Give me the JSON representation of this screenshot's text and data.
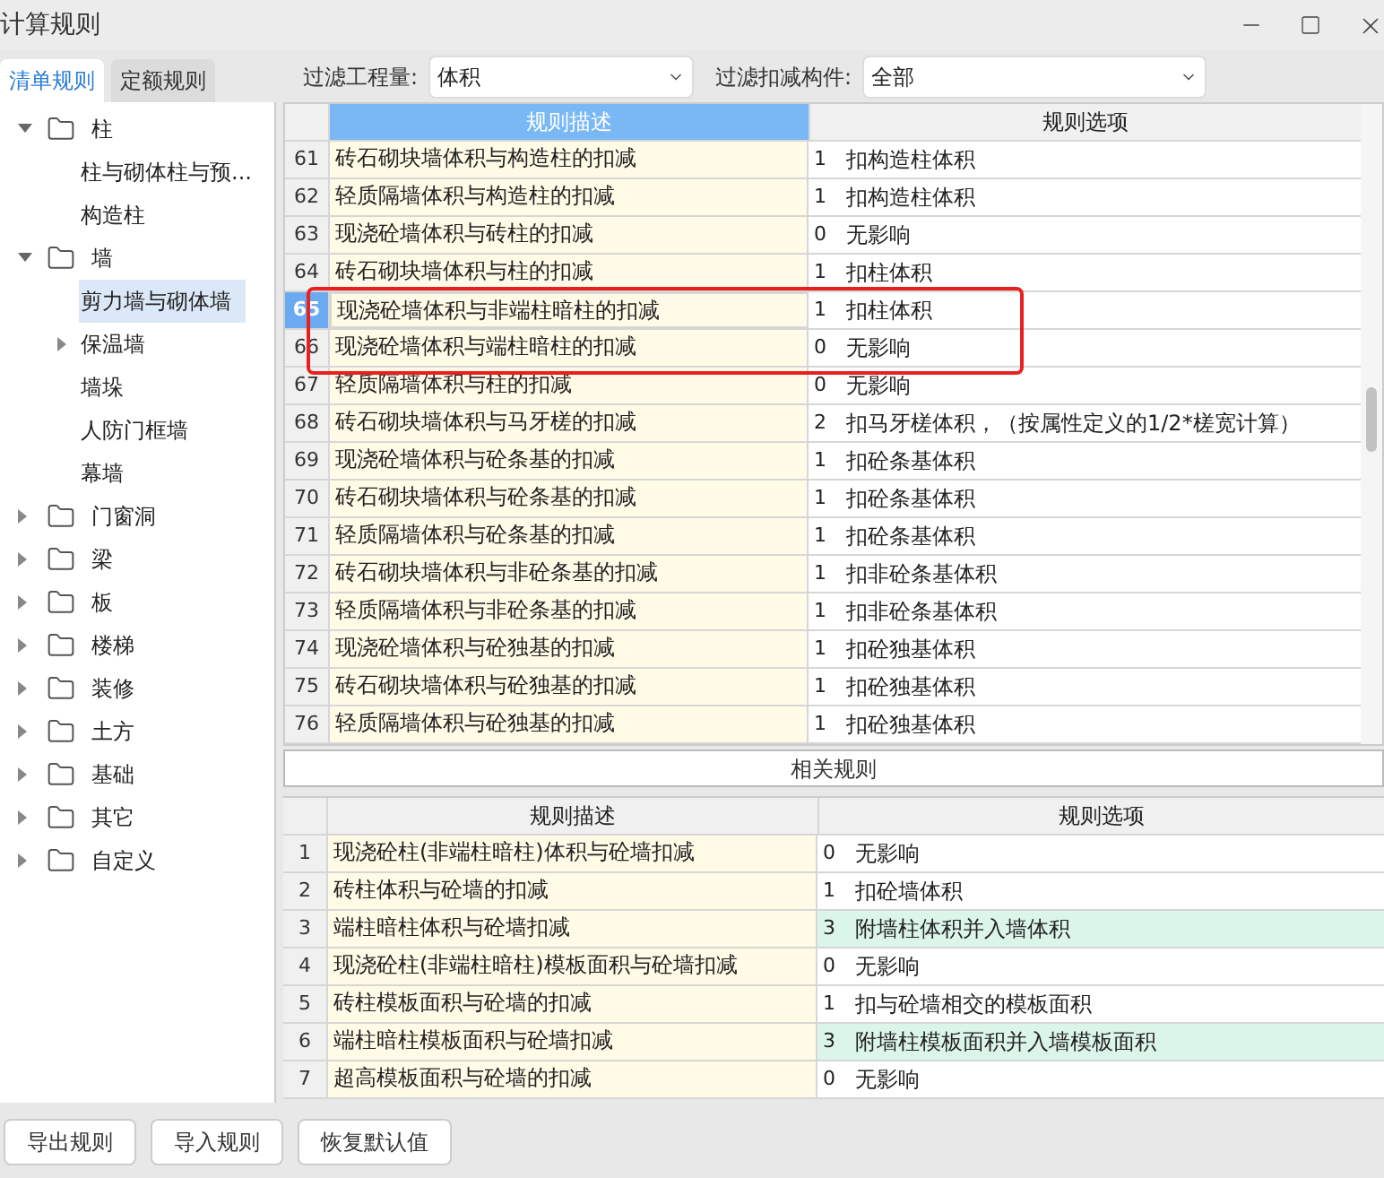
{
  "window": {
    "title": "计算规则"
  },
  "tabs": [
    {
      "label": "清单规则",
      "selected": true
    },
    {
      "label": "定额规则",
      "selected": false
    }
  ],
  "filters": [
    {
      "label": "过滤工程量:",
      "value": "体积"
    },
    {
      "label": "过滤扣减构件:",
      "value": "全部"
    }
  ],
  "tree": [
    {
      "label": "柱",
      "folder": true,
      "expanded": true,
      "selected": false,
      "children": [
        {
          "label": "柱与砌体柱与预...",
          "folder": false,
          "selected": false
        },
        {
          "label": "构造柱",
          "folder": false,
          "selected": false
        }
      ]
    },
    {
      "label": "墙",
      "folder": true,
      "expanded": true,
      "selected": false,
      "children": [
        {
          "label": "剪力墙与砌体墙",
          "folder": false,
          "selected": true
        },
        {
          "label": "保温墙",
          "folder": false,
          "expanded": false,
          "selected": false
        },
        {
          "label": "墙垛",
          "folder": false,
          "selected": false
        },
        {
          "label": "人防门框墙",
          "folder": false,
          "selected": false
        },
        {
          "label": "幕墙",
          "folder": false,
          "selected": false
        }
      ]
    },
    {
      "label": "门窗洞",
      "folder": true,
      "expanded": false,
      "selected": false
    },
    {
      "label": "梁",
      "folder": true,
      "expanded": false,
      "selected": false
    },
    {
      "label": "板",
      "folder": true,
      "expanded": false,
      "selected": false
    },
    {
      "label": "楼梯",
      "folder": true,
      "expanded": false,
      "selected": false
    },
    {
      "label": "装修",
      "folder": true,
      "expanded": false,
      "selected": false
    },
    {
      "label": "土方",
      "folder": true,
      "expanded": false,
      "selected": false
    },
    {
      "label": "基础",
      "folder": true,
      "expanded": false,
      "selected": false
    },
    {
      "label": "其它",
      "folder": true,
      "expanded": false,
      "selected": false
    },
    {
      "label": "自定义",
      "folder": true,
      "expanded": false,
      "selected": false
    }
  ],
  "rules_table": {
    "columns": [
      "规则描述",
      "规则选项"
    ],
    "rows": [
      {
        "no": "61",
        "description": "砖石砌块墙体积与构造柱的扣减",
        "code": "1",
        "option": "扣构造柱体积",
        "selected": false,
        "highlighted": false
      },
      {
        "no": "62",
        "description": "轻质隔墙体积与构造柱的扣减",
        "code": "1",
        "option": "扣构造柱体积",
        "selected": false,
        "highlighted": false
      },
      {
        "no": "63",
        "description": "现浇砼墙体积与砖柱的扣减",
        "code": "0",
        "option": "无影响",
        "selected": false,
        "highlighted": false
      },
      {
        "no": "64",
        "description": "砖石砌块墙体积与柱的扣减",
        "code": "1",
        "option": "扣柱体积",
        "selected": false,
        "highlighted": false
      },
      {
        "no": "65",
        "description": "现浇砼墙体积与非端柱暗柱的扣减",
        "code": "1",
        "option": "扣柱体积",
        "selected": true,
        "highlighted": true
      },
      {
        "no": "66",
        "description": "现浇砼墙体积与端柱暗柱的扣减",
        "code": "0",
        "option": "无影响",
        "selected": false,
        "highlighted": true
      },
      {
        "no": "67",
        "description": "轻质隔墙体积与柱的扣减",
        "code": "0",
        "option": "无影响",
        "selected": false,
        "highlighted": false
      },
      {
        "no": "68",
        "description": "砖石砌块墙体积与马牙槎的扣减",
        "code": "2",
        "option": "扣马牙槎体积，（按属性定义的1/2*槎宽计算）",
        "selected": false,
        "highlighted": false
      },
      {
        "no": "69",
        "description": "现浇砼墙体积与砼条基的扣减",
        "code": "1",
        "option": "扣砼条基体积",
        "selected": false,
        "highlighted": false
      },
      {
        "no": "70",
        "description": "砖石砌块墙体积与砼条基的扣减",
        "code": "1",
        "option": "扣砼条基体积",
        "selected": false,
        "highlighted": false
      },
      {
        "no": "71",
        "description": "轻质隔墙体积与砼条基的扣减",
        "code": "1",
        "option": "扣砼条基体积",
        "selected": false,
        "highlighted": false
      },
      {
        "no": "72",
        "description": "砖石砌块墙体积与非砼条基的扣减",
        "code": "1",
        "option": "扣非砼条基体积",
        "selected": false,
        "highlighted": false
      },
      {
        "no": "73",
        "description": "轻质隔墙体积与非砼条基的扣减",
        "code": "1",
        "option": "扣非砼条基体积",
        "selected": false,
        "highlighted": false
      },
      {
        "no": "74",
        "description": "现浇砼墙体积与砼独基的扣减",
        "code": "1",
        "option": "扣砼独基体积",
        "selected": false,
        "highlighted": false
      },
      {
        "no": "75",
        "description": "砖石砌块墙体积与砼独基的扣减",
        "code": "1",
        "option": "扣砼独基体积",
        "selected": false,
        "highlighted": false
      },
      {
        "no": "76",
        "description": "轻质隔墙体积与砼独基的扣减",
        "code": "1",
        "option": "扣砼独基体积",
        "selected": false,
        "highlighted": false
      }
    ]
  },
  "related": {
    "title": "相关规则",
    "columns": [
      "规则描述",
      "规则选项"
    ],
    "rows": [
      {
        "no": "1",
        "description": "现浇砼柱(非端柱暗柱)体积与砼墙扣减",
        "code": "0",
        "option": "无影响",
        "highlighted": false
      },
      {
        "no": "2",
        "description": "砖柱体积与砼墙的扣减",
        "code": "1",
        "option": "扣砼墙体积",
        "highlighted": false
      },
      {
        "no": "3",
        "description": "端柱暗柱体积与砼墙扣减",
        "code": "3",
        "option": "附墙柱体积并入墙体积",
        "highlighted": true
      },
      {
        "no": "4",
        "description": "现浇砼柱(非端柱暗柱)模板面积与砼墙扣减",
        "code": "0",
        "option": "无影响",
        "highlighted": false
      },
      {
        "no": "5",
        "description": "砖柱模板面积与砼墙的扣减",
        "code": "1",
        "option": "扣与砼墙相交的模板面积",
        "highlighted": false
      },
      {
        "no": "6",
        "description": "端柱暗柱模板面积与砼墙扣减",
        "code": "3",
        "option": "附墙柱模板面积并入墙模板面积",
        "highlighted": true
      },
      {
        "no": "7",
        "description": "超高模板面积与砼墙的扣减",
        "code": "0",
        "option": "无影响",
        "highlighted": false
      }
    ]
  },
  "buttons": [
    "导出规则",
    "导入规则",
    "恢复默认值"
  ]
}
